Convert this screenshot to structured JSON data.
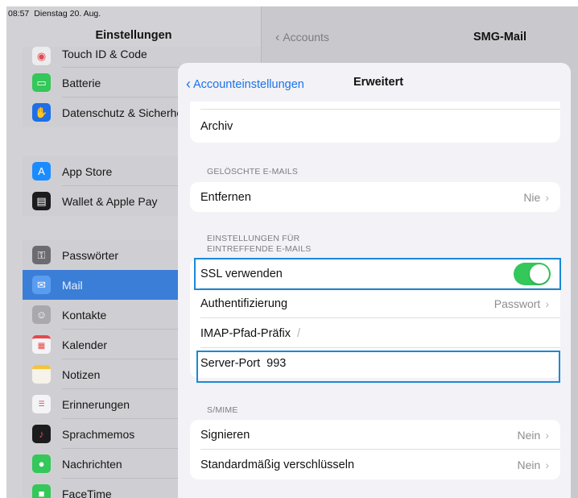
{
  "status_bar": {
    "time": "08:57",
    "date": "Dienstag 20. Aug."
  },
  "sidebar": {
    "title": "Einstellungen",
    "groups": [
      {
        "items": [
          {
            "label": "Touch ID & Code",
            "icon": "fingerprint-icon",
            "color": "#e5484d"
          },
          {
            "label": "Batterie",
            "icon": "battery-icon",
            "color": "#34c759"
          },
          {
            "label": "Datenschutz & Sicherheit",
            "icon": "hand-icon",
            "color": "#1f6fe5"
          }
        ]
      },
      {
        "items": [
          {
            "label": "App Store",
            "icon": "appstore-icon",
            "color": "#1a8cff"
          },
          {
            "label": "Wallet & Apple Pay",
            "icon": "wallet-icon",
            "color": "#1c1c1e"
          }
        ]
      },
      {
        "items": [
          {
            "label": "Passwörter",
            "icon": "key-icon",
            "color": "#6b6b70"
          },
          {
            "label": "Mail",
            "icon": "mail-icon",
            "color": "#2f86f0",
            "selected": true
          },
          {
            "label": "Kontakte",
            "icon": "contacts-icon",
            "color": "#a8a8ad"
          },
          {
            "label": "Kalender",
            "icon": "calendar-icon",
            "color": "#ffffff"
          },
          {
            "label": "Notizen",
            "icon": "notes-icon",
            "color": "#f5c43b"
          },
          {
            "label": "Erinnerungen",
            "icon": "reminders-icon",
            "color": "#ffffff"
          },
          {
            "label": "Sprachmemos",
            "icon": "voice-memo-icon",
            "color": "#1c1c1e"
          },
          {
            "label": "Nachrichten",
            "icon": "messages-icon",
            "color": "#34c759"
          },
          {
            "label": "FaceTime",
            "icon": "facetime-icon",
            "color": "#34c759"
          }
        ]
      }
    ]
  },
  "detail": {
    "back_label": "Accounts",
    "title": "SMG-Mail"
  },
  "sheet": {
    "back_label": "Accounteinstellungen",
    "title": "Erweitert",
    "archive_label": "Archiv",
    "deleted_section": "GELÖSCHTE E-MAILS",
    "remove_label": "Entfernen",
    "remove_value": "Nie",
    "incoming_section_line1": "EINSTELLUNGEN FÜR",
    "incoming_section_line2": "EINTREFFENDE E-MAILS",
    "ssl_label": "SSL verwenden",
    "ssl_on": true,
    "auth_label": "Authentifizierung",
    "auth_value": "Passwort",
    "imap_label": "IMAP-Pfad-Präfix",
    "imap_value": "/",
    "port_label": "Server-Port",
    "port_value": "993",
    "smime_section": "S/MIME",
    "sign_label": "Signieren",
    "sign_value": "Nein",
    "encrypt_label": "Standardmäßig verschlüsseln",
    "encrypt_value": "Nein",
    "chevron": "›",
    "colors": {
      "accent": "#1a73e8",
      "toggle_on": "#34c759",
      "highlight": "#1a8ad6"
    }
  }
}
